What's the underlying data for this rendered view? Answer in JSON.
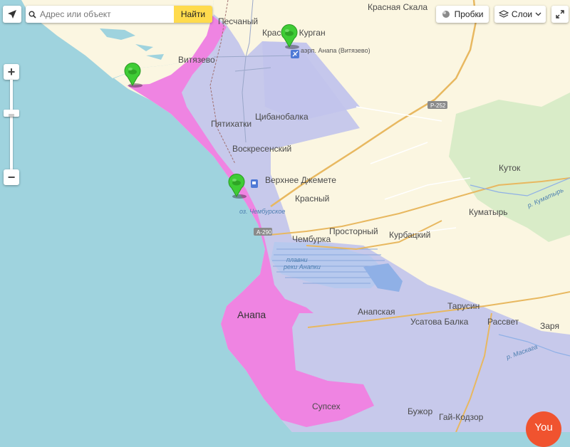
{
  "search": {
    "placeholder": "Адрес или объект",
    "button_label": "Найти"
  },
  "controls": {
    "traffic_label": "Пробки",
    "layers_label": "Слои",
    "you_label": "You"
  },
  "colors": {
    "sea": "#9fd3de",
    "land": "#fbf6e1",
    "zone_lavender": "#c2c4ec",
    "zone_magenta": "#ef84e2",
    "marker_green": "#3fcc35",
    "search_button": "#ffdb4d",
    "you_button": "#f0532f"
  },
  "places": {
    "pesчаный": "Песчаный",
    "krasnaya_skala": "Красная Скала",
    "krasny_kurgan": "Красный Курган",
    "airport": "аэрп. Анапа (Витязево)",
    "vityazevo": "Витязево",
    "pyatikhatki": "Пятихатки",
    "tsibanobalka": "Цибанобалка",
    "voskresensky": "Воскресенский",
    "verkhnee_dzhemete": "Верхнее Джемете",
    "krasny": "Красный",
    "kutok": "Куток",
    "kumatyr": "Куматырь",
    "prostorny": "Просторный",
    "kurbatsky": "Курбацкий",
    "chemburka": "Чембурка",
    "anapa": "Анапа",
    "anapskaya": "Анапская",
    "tarusin": "Тарусин",
    "usatova_balka": "Усатова Балка",
    "rassvet": "Рассвет",
    "zarya": "Заря",
    "supsekh": "Супсех",
    "buzhor": "Бужор",
    "gai_kodzor": "Гай-Кодзор"
  },
  "water": {
    "lake": "оз. Чембурское",
    "plavni_1": "плавни",
    "plavni_2": "реки Анапки",
    "river_kumatyr": "р. Куматырь",
    "river_maskaga": "р. Маскага"
  },
  "roads": {
    "r252": "Р-252",
    "a290": "А-290"
  },
  "markers": [
    "marker-vityazevo",
    "marker-krasny-kurgan",
    "marker-dzhemete"
  ]
}
